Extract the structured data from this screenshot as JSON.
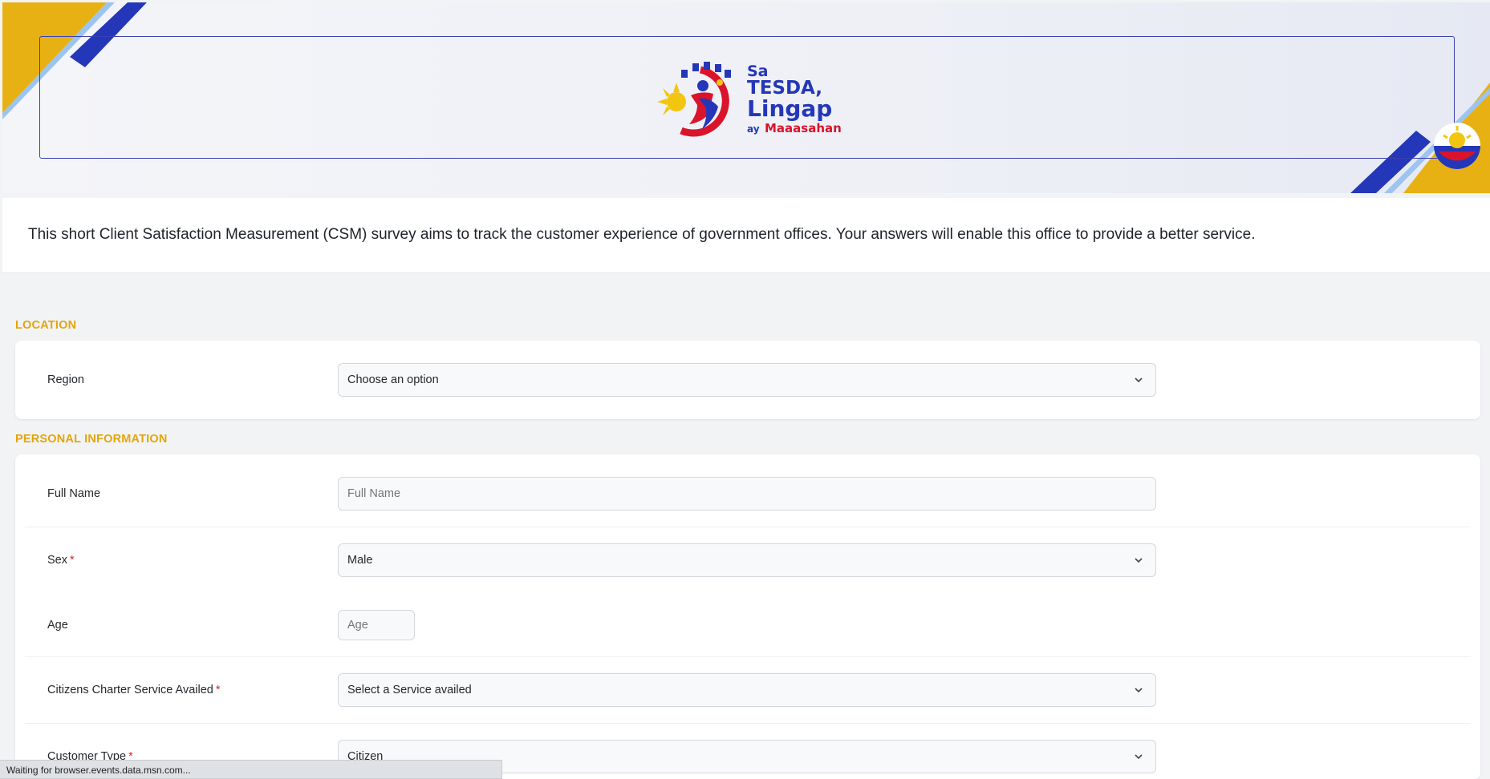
{
  "banner": {
    "logo": {
      "line1": "Sa",
      "line2": "TESDA,",
      "line3": "Lingap",
      "line4_small": "ay",
      "line4": "Maaasahan"
    }
  },
  "intro": {
    "text": "This short Client Satisfaction Measurement (CSM) survey aims to track the customer experience of government offices. Your answers will enable this office to provide a better service."
  },
  "sections": {
    "location": {
      "heading": "LOCATION",
      "region_label": "Region",
      "region_value": "Choose an option"
    },
    "personal": {
      "heading": "PERSONAL INFORMATION",
      "full_name_label": "Full Name",
      "full_name_placeholder": "Full Name",
      "sex_label": "Sex",
      "sex_value": "Male",
      "age_label": "Age",
      "age_placeholder": "Age",
      "service_label": "Citizens Charter Service Availed",
      "service_value": "Select a Service availed",
      "customer_type_label": "Customer Type",
      "customer_type_value": "Citizen",
      "required_mark": "*"
    }
  },
  "status_bar": {
    "text": "Waiting for browser.events.data.msn.com..."
  },
  "colors": {
    "accent_yellow": "#e5a50a",
    "brand_blue": "#2437b8",
    "brand_red": "#d9142b",
    "required_red": "#e02424"
  },
  "icons": [
    "chevron-down-icon",
    "tesda-logo",
    "philippine-sun-emblem"
  ]
}
